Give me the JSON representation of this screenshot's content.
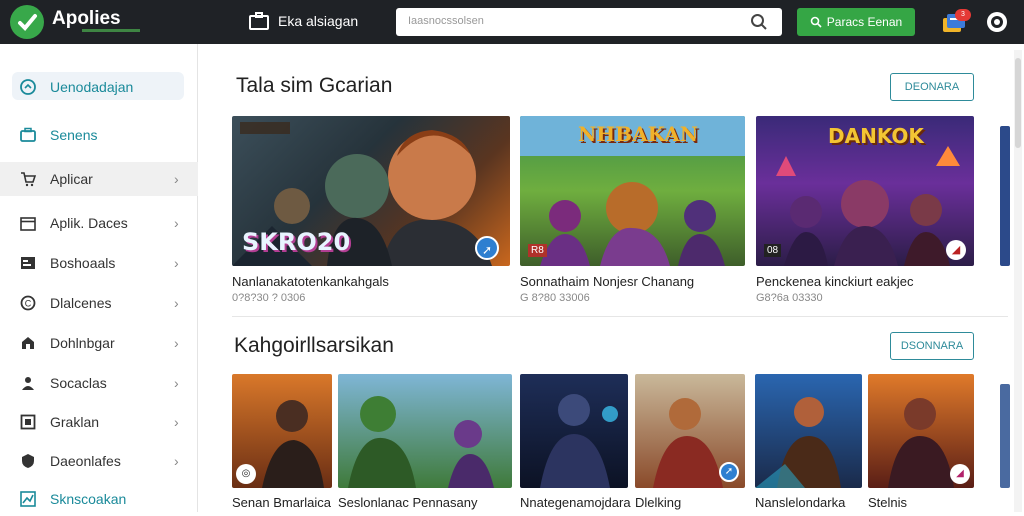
{
  "header": {
    "logo_text": "Apolies",
    "center_label": "Eka alsiagan",
    "search_placeholder": "Iaasnocssolsen",
    "green_button_label": "Paracs Eenan",
    "notification_count": "3"
  },
  "sidebar": {
    "items": [
      {
        "label": "Uenodadajan",
        "icon": "home-icon"
      },
      {
        "label": "Senens",
        "icon": "briefcase-icon"
      },
      {
        "label": "Aplicar",
        "icon": "cart-icon"
      },
      {
        "label": "Aplik. Daces",
        "icon": "calendar-icon"
      },
      {
        "label": "Boshoaals",
        "icon": "book-icon"
      },
      {
        "label": "Dlalcenes",
        "icon": "coin-icon"
      },
      {
        "label": "Dohlnbgar",
        "icon": "lock-icon"
      },
      {
        "label": "Socaclas",
        "icon": "person-icon"
      },
      {
        "label": "Graklan",
        "icon": "grid-icon"
      },
      {
        "label": "Daeonlafes",
        "icon": "shield-icon"
      },
      {
        "label": "Sknscoakan",
        "icon": "chart-icon"
      }
    ]
  },
  "sections": [
    {
      "title": "Tala sim Gcarian",
      "button_label": "DEONARA",
      "cards": [
        {
          "title": "Nanlanakatotenkankahgals",
          "sub": "0?8?30 ? 0306",
          "art_text": "SKRO20",
          "corner": "▲"
        },
        {
          "title": "Sonnathaim Nonjesr Chanang",
          "sub": "G 8?80 33006",
          "art_text": "NHBAKAN",
          "corner": "R8"
        },
        {
          "title": "Penckenea kinckiurt eakjec",
          "sub": "G8?6a 03330",
          "art_text": "DANKOK",
          "corner": "08"
        }
      ]
    },
    {
      "title": "Kahgoirllsarsikan",
      "button_label": "DSONNARA",
      "cards": [
        {
          "title": "Senan Bmarlaica"
        },
        {
          "title": "Seslonlanac Pennasany"
        },
        {
          "title": "Nnategenamojdara"
        },
        {
          "title": "Dlelking"
        },
        {
          "title": "Nanslelondarka"
        },
        {
          "title": "Stelnis"
        }
      ]
    }
  ]
}
